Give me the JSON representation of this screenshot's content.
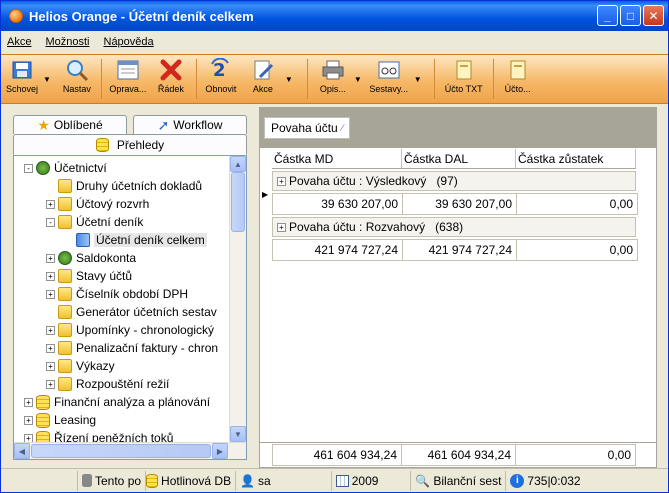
{
  "window": {
    "title": "Helios Orange - Účetní deník celkem"
  },
  "menu": [
    "Akce",
    "Možnosti",
    "Nápověda"
  ],
  "toolbar": [
    {
      "label": "Schovej",
      "icon": "save-icon"
    },
    {
      "label": "Nastav",
      "icon": "magnifier-icon"
    },
    {
      "label": "Oprava...",
      "icon": "form-edit-icon"
    },
    {
      "label": "Řádek",
      "icon": "delete-row-icon"
    },
    {
      "label": "Obnovit",
      "icon": "refresh-icon"
    },
    {
      "label": "Akce",
      "icon": "document-pencil-icon"
    },
    {
      "label": "Opis...",
      "icon": "printer-icon"
    },
    {
      "label": "Sestavy...",
      "icon": "glasses-icon"
    },
    {
      "label": "Účto TXT",
      "icon": "document-icon"
    },
    {
      "label": "Účto...",
      "icon": "document-icon"
    }
  ],
  "tabs": {
    "oblibene": "Oblíbené",
    "workflow": "Workflow",
    "prehledy": "Přehledy"
  },
  "tree": [
    {
      "label": "Účetnictví",
      "level": 0,
      "expander": "-",
      "icon": "coins"
    },
    {
      "label": "Druhy účetních dokladů",
      "level": 1,
      "expander": "",
      "icon": "folder"
    },
    {
      "label": "Účtový rozvrh",
      "level": 1,
      "expander": "+",
      "icon": "folder"
    },
    {
      "label": "Účetní deník",
      "level": 1,
      "expander": "-",
      "icon": "folder"
    },
    {
      "label": "Účetní deník celkem",
      "level": 2,
      "expander": "",
      "icon": "book",
      "selected": true
    },
    {
      "label": "Saldokonta",
      "level": 1,
      "expander": "+",
      "icon": "coins"
    },
    {
      "label": "Stavy účtů",
      "level": 1,
      "expander": "+",
      "icon": "folder"
    },
    {
      "label": "Číselník období DPH",
      "level": 1,
      "expander": "+",
      "icon": "folder"
    },
    {
      "label": "Generátor účetních sestav",
      "level": 1,
      "expander": "",
      "icon": "folder"
    },
    {
      "label": "Upomínky - chronologický",
      "level": 1,
      "expander": "+",
      "icon": "folder"
    },
    {
      "label": "Penalizační faktury - chron",
      "level": 1,
      "expander": "+",
      "icon": "folder"
    },
    {
      "label": "Výkazy",
      "level": 1,
      "expander": "+",
      "icon": "folder"
    },
    {
      "label": "Rozpouštění režií",
      "level": 1,
      "expander": "+",
      "icon": "folder"
    },
    {
      "label": "Finanční analýza a plánování",
      "level": 0,
      "expander": "+",
      "icon": "db"
    },
    {
      "label": "Leasing",
      "level": 0,
      "expander": "+",
      "icon": "db"
    },
    {
      "label": "Řízení peněžních toků",
      "level": 0,
      "expander": "+",
      "icon": "db"
    }
  ],
  "grid": {
    "group_chip": "Povaha účtu",
    "columns": [
      "Částka MD",
      "Částka DAL",
      "Částka zůstatek"
    ],
    "groups": [
      {
        "label": "Povaha účtu : Výsledkový",
        "count": "(97)",
        "values": [
          "39 630 207,00",
          "39 630 207,00",
          "0,00"
        ]
      },
      {
        "label": "Povaha účtu : Rozvahový",
        "count": "(638)",
        "values": [
          "421 974 727,24",
          "421 974 727,24",
          "0,00"
        ]
      }
    ],
    "totals": [
      "461 604 934,24",
      "461 604 934,24",
      "0,00"
    ]
  },
  "status": {
    "tento": "Tento po",
    "hotline": "Hotlinová DB",
    "user": "sa",
    "year": "2009",
    "bilancni": "Bilanční sest",
    "counter": "735|0:032"
  }
}
